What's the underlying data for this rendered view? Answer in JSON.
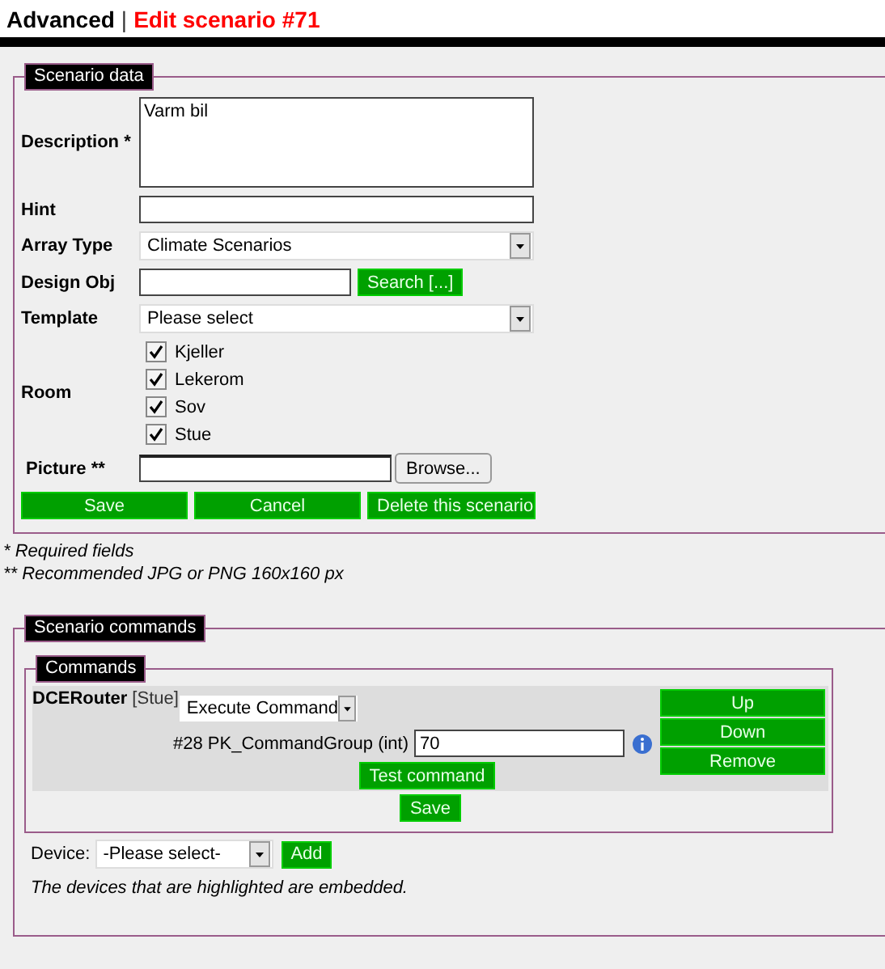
{
  "header": {
    "section": "Advanced",
    "separator": "|",
    "title": "Edit scenario #71"
  },
  "scenario_data": {
    "legend": "Scenario data",
    "fields": [
      {
        "kind": "textarea",
        "label": "Description *",
        "value": "Varm bil"
      },
      {
        "kind": "text",
        "label": "Hint"
      },
      {
        "kind": "select",
        "label": "Array Type",
        "value": "Climate Scenarios"
      },
      {
        "kind": "search",
        "label": "Design Obj",
        "button": "Search [...]"
      },
      {
        "kind": "select",
        "label": "Template",
        "value": "Please select"
      },
      {
        "kind": "checks",
        "label": "Room",
        "options": [
          {
            "label": "Kjeller",
            "checked": true
          },
          {
            "label": "Lekerom",
            "checked": true
          },
          {
            "label": "Sov",
            "checked": true
          },
          {
            "label": "Stue",
            "checked": true
          }
        ]
      },
      {
        "kind": "file",
        "label": "Picture **",
        "button": "Browse..."
      }
    ],
    "buttons": [
      "Save",
      "Cancel",
      "Delete this scenario"
    ]
  },
  "notes": [
    "* Required fields",
    "** Recommended JPG or PNG 160x160 px"
  ],
  "scenario_commands": {
    "legend": "Scenario commands",
    "commands": {
      "legend": "Commands",
      "device": "DCERouter",
      "room": "[Stue]",
      "command": "Execute Command",
      "param_label": "#28 PK_CommandGroup (int)",
      "param_value": "70",
      "side_buttons": [
        "Up",
        "Down",
        "Remove"
      ],
      "test_button": "Test command",
      "save_button": "Save"
    },
    "device_label": "Device:",
    "device_select": "-Please select-",
    "add_button": "Add",
    "note": "The devices that are highlighted are embedded."
  }
}
